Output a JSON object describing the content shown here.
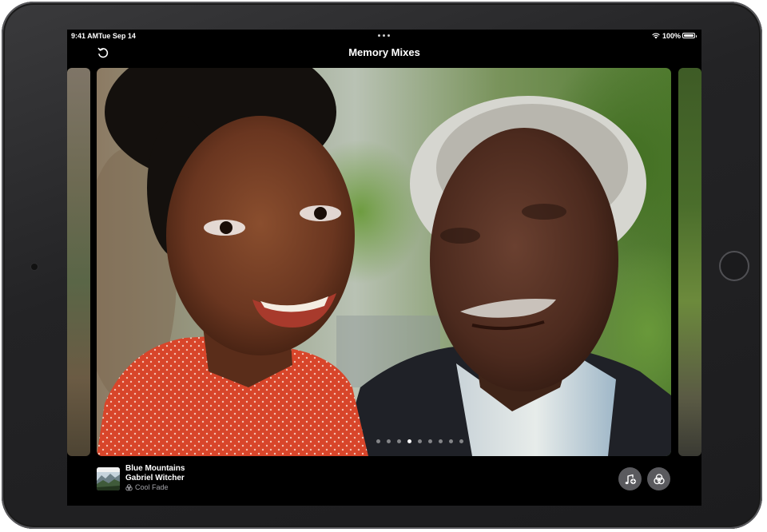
{
  "status_bar": {
    "time": "9:41 AM",
    "date": "Tue Sep 14",
    "battery": "100%"
  },
  "nav": {
    "title": "Memory Mixes"
  },
  "carousel": {
    "page_count": 9,
    "active_page": 4
  },
  "now_playing": {
    "song_title": "Blue Mountains",
    "artist": "Gabriel Witcher",
    "look": "Cool Fade"
  },
  "icons": {
    "back": "rotate-back-icon",
    "music": "music-note-plus-icon",
    "looks": "three-circles-filter-icon",
    "wifi": "wifi-icon",
    "battery": "battery-icon"
  },
  "colors": {
    "screen_background": "#000000",
    "button_background": "#5a5a5e",
    "secondary_text": "#a3a3a8"
  }
}
